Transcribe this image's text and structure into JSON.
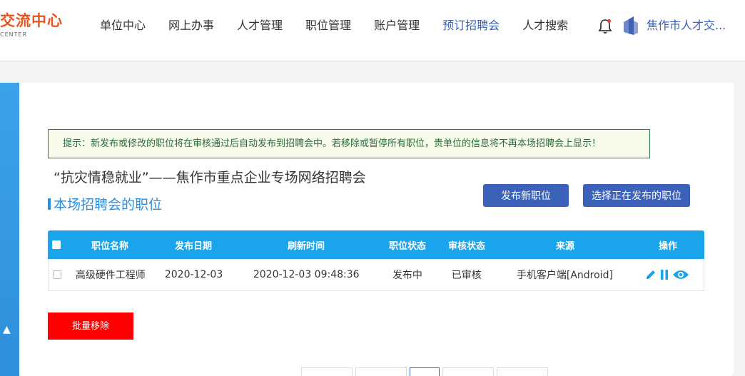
{
  "header": {
    "logo_cn": "交流中心",
    "logo_en": "CENTER",
    "nav": [
      {
        "label": "单位中心"
      },
      {
        "label": "网上办事"
      },
      {
        "label": "人才管理"
      },
      {
        "label": "职位管理"
      },
      {
        "label": "账户管理"
      },
      {
        "label": "预订招聘会",
        "active": true
      },
      {
        "label": "人才搜索"
      }
    ],
    "user_name": "焦作市人才交..."
  },
  "tip": "提示：新发布或修改的职位将在审核通过后自动发布到招聘会中。若移除或暂停所有职位，贵单位的信息将不再本场招聘会上显示！",
  "fair_title": "“抗灾情稳就业”——焦作市重点企业专场网络招聘会",
  "section_title": "本场招聘会的职位",
  "buttons": {
    "publish": "发布新职位",
    "select": "选择正在发布的职位",
    "remove": "批量移除"
  },
  "table": {
    "headers": {
      "name": "职位名称",
      "date": "发布日期",
      "refresh": "刷新时间",
      "status": "职位状态",
      "audit": "审核状态",
      "source": "来源",
      "ops": "操作"
    },
    "rows": [
      {
        "name": "高级硬件工程师",
        "date": "2020-12-03",
        "refresh": "2020-12-03 09:48:36",
        "status": "发布中",
        "audit": "已审核",
        "source": "手机客户端[Android]"
      }
    ]
  },
  "colors": {
    "brand": "#e8541b",
    "nav_active": "#3b62b8",
    "table_header": "#1aa4ec",
    "remove": "#ff0000"
  },
  "icons": [
    "bell-icon",
    "company-logo-icon",
    "edit-icon",
    "pause-icon",
    "view-icon",
    "arrow-up-icon"
  ]
}
